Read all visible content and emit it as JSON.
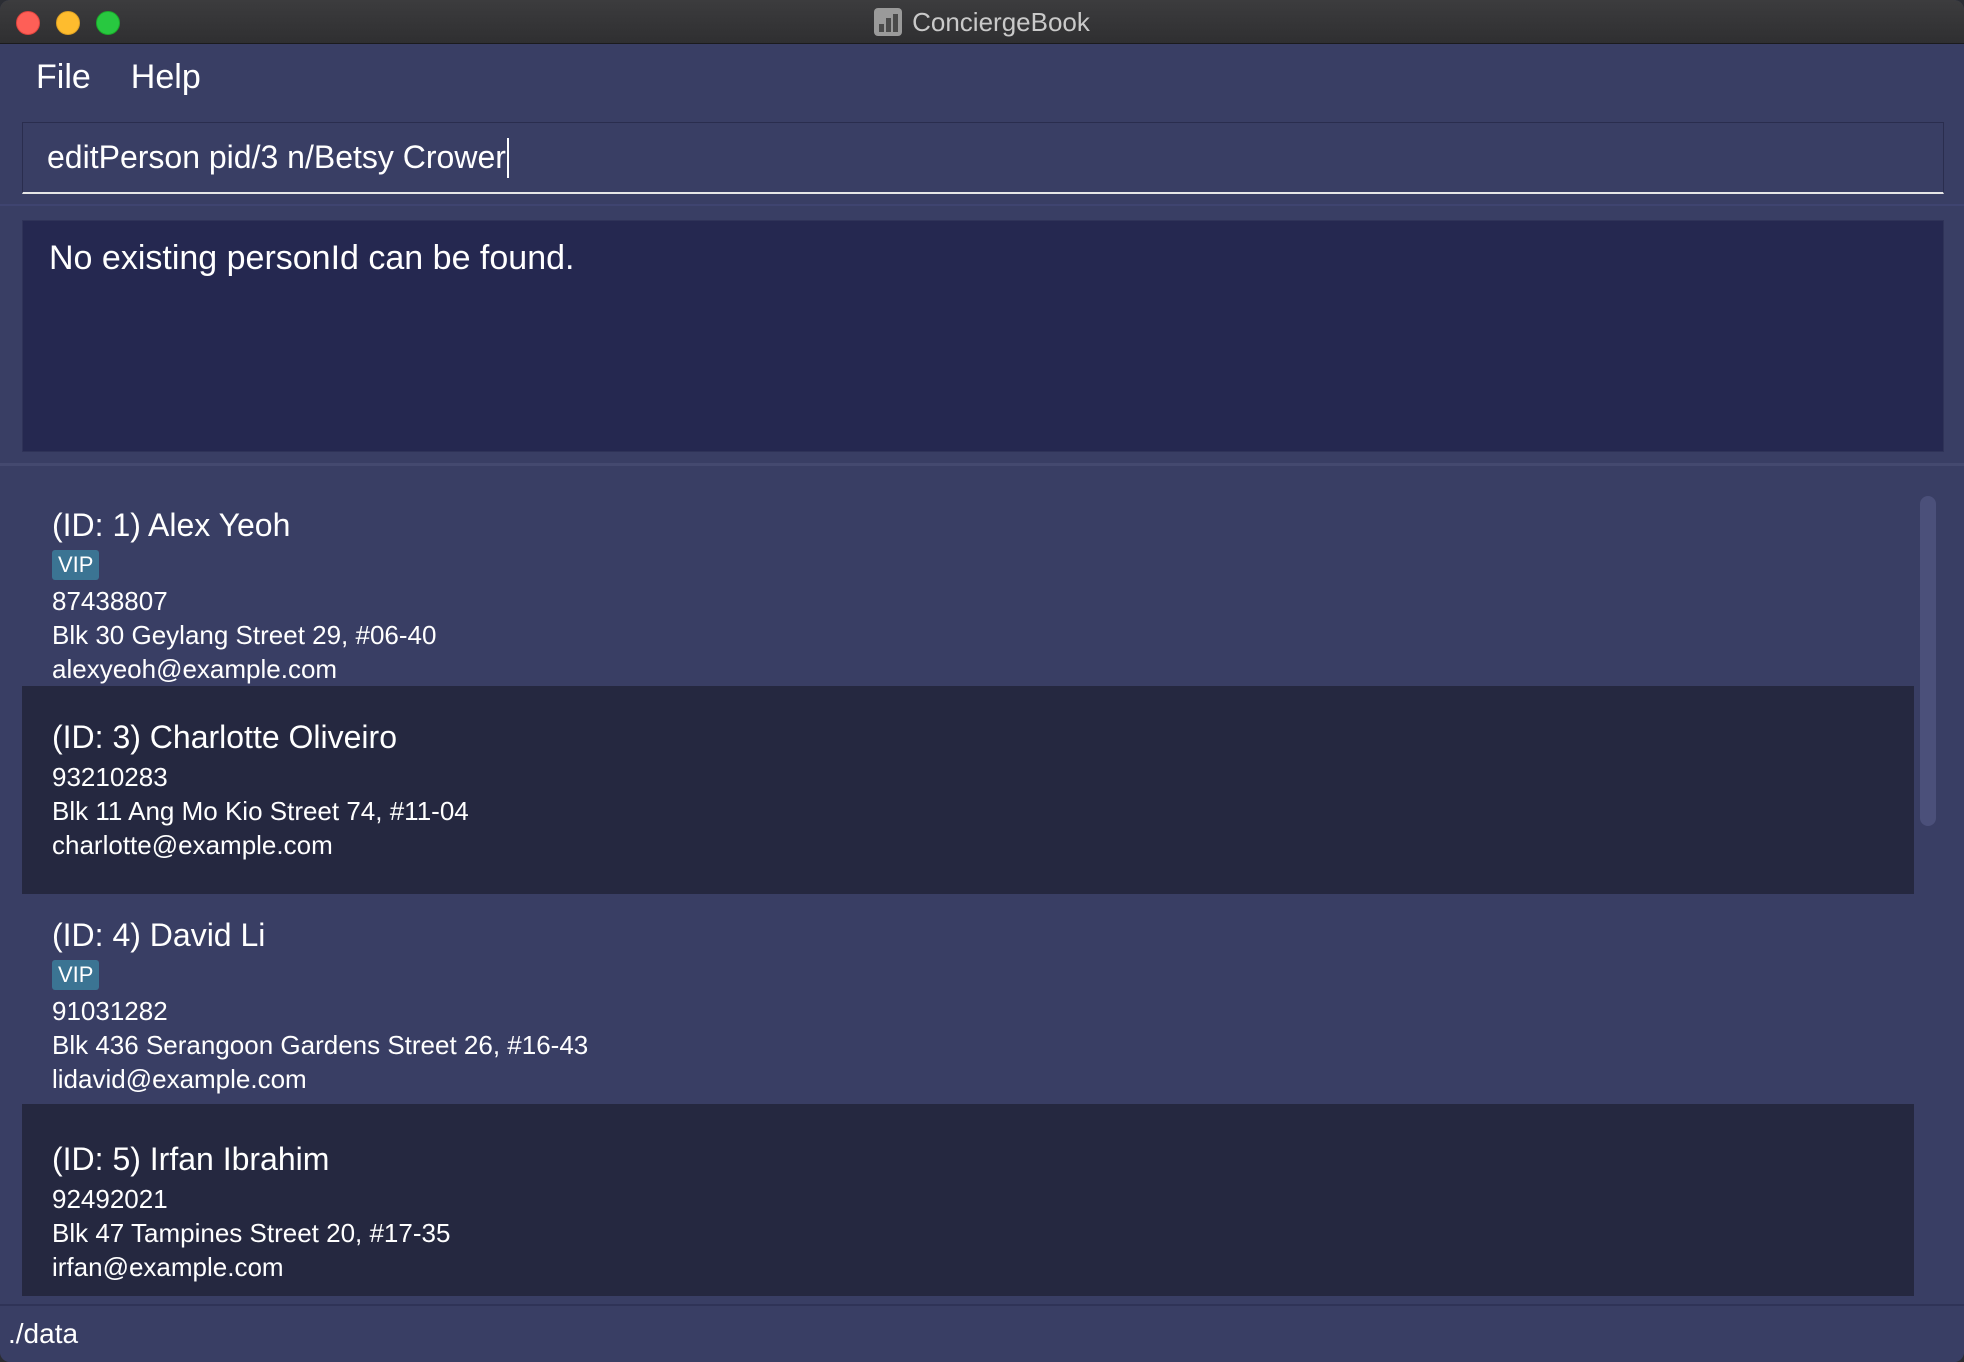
{
  "window": {
    "title": "ConciergeBook",
    "colors": {
      "background": "#393e64",
      "result_bg": "#252850",
      "card_alt": "#252840",
      "tag": "#3b7493"
    }
  },
  "menu": {
    "file": "File",
    "help": "Help"
  },
  "command": {
    "value": "editPerson pid/3 n/Betsy Crower"
  },
  "result": {
    "message": "No existing personId can be found."
  },
  "persons": [
    {
      "name": "(ID: 1) Alex Yeoh",
      "tag": "VIP",
      "phone": "87438807",
      "address": "Blk 30 Geylang Street 29, #06-40",
      "email": "alexyeoh@example.com"
    },
    {
      "name": "(ID: 3) Charlotte Oliveiro",
      "phone": "93210283",
      "address": "Blk 11 Ang Mo Kio Street 74, #11-04",
      "email": "charlotte@example.com"
    },
    {
      "name": "(ID: 4) David Li",
      "tag": "VIP",
      "phone": "91031282",
      "address": "Blk 436 Serangoon Gardens Street 26, #16-43",
      "email": "lidavid@example.com"
    },
    {
      "name": "(ID: 5) Irfan Ibrahim",
      "phone": "92492021",
      "address": "Blk 47 Tampines Street 20, #17-35",
      "email": "irfan@example.com"
    }
  ],
  "status": {
    "path": "./data"
  }
}
